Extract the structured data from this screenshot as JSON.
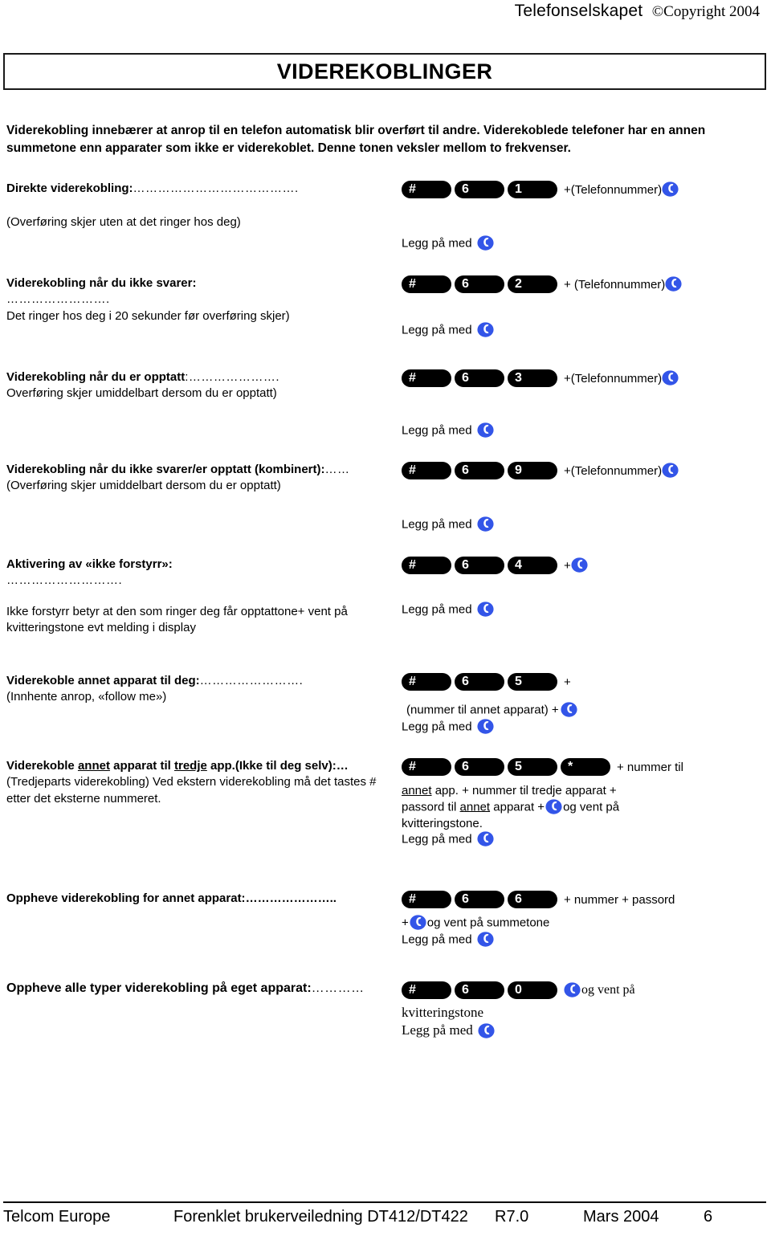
{
  "header": {
    "company": "Telefonselskapet",
    "copyright": "©Copyright 2004"
  },
  "title": "VIDEREKOBLINGER",
  "intro": "Viderekobling innebærer at anrop til en telefon automatisk blir overført til andre.  Viderekoblede telefoner har en annen summetone enn apparater som ikke er viderekoblet.  Denne tonen veksler mellom to frekvenser.",
  "hangup_label": "Legg på med",
  "icons": {
    "phone": "phone-handset-icon",
    "phone_color": "#3355E8"
  },
  "key_colors": {
    "key_bg": "#000000",
    "key_fg": "#ffffff"
  },
  "sections": [
    {
      "label": "Direkte viderekobling:",
      "leader": "………………………………….",
      "note": "(Overføring skjer uten at det ringer hos deg)",
      "keys": [
        "#",
        "6",
        "1"
      ],
      "after_keys": "+(Telefonnummer)",
      "after_keys_phone": true,
      "hangup": true
    },
    {
      "label": "Viderekobling når du ikke svarer:",
      "leader": "…………………….",
      "note": "Det ringer hos deg i 20 sekunder før overføring skjer)",
      "keys": [
        "#",
        "6",
        "2"
      ],
      "after_keys": "+  (Telefonnummer)",
      "after_keys_phone": true,
      "hangup": true
    },
    {
      "label": "Viderekobling når du er opptatt",
      "leader": ":………………….",
      "note": "Overføring skjer umiddelbart dersom du er opptatt)",
      "keys": [
        "#",
        "6",
        "3"
      ],
      "after_keys": "+(Telefonnummer)",
      "after_keys_phone": true,
      "hangup": true
    },
    {
      "label": "Viderekobling når du ikke svarer/er opptatt (kombinert):",
      "leader": "……",
      "note": " (Overføring skjer umiddelbart dersom du er opptatt)",
      "keys": [
        "#",
        "6",
        "9"
      ],
      "after_keys": "+(Telefonnummer)",
      "after_keys_phone": true,
      "hangup": true
    },
    {
      "label": "Aktivering av «ikke forstyrr»:",
      "leader": "……………………….",
      "note": "Ikke forstyrr betyr at den som ringer deg får opptattone+ vent på kvitteringstone evt melding i display",
      "keys": [
        "#",
        "6",
        "4"
      ],
      "after_keys": "+",
      "after_keys_phone": true,
      "hangup": true
    },
    {
      "label": "Viderekoble annet apparat til deg:",
      "leader": "…………………….",
      "note": "(Innhente anrop, «follow me»)",
      "keys": [
        "#",
        "6",
        "5"
      ],
      "after_keys": "+",
      "after_keys_phone": false,
      "extra_line": "(nummer til annet apparat) +",
      "extra_line_phone": true,
      "hangup": true
    }
  ],
  "third_party": {
    "label_bold_1": "Viderekoble ",
    "label_ul_1": "annet",
    "label_bold_2": " apparat til ",
    "label_ul_2": "tredje",
    "label_bold_3": " app.(Ikke til deg selv):",
    "leader": "…",
    "note": " (Tredjeparts viderekobling) Ved ekstern viderekobling må det tastes # etter det eksterne nummeret.",
    "keys": [
      "#",
      "6",
      "5",
      "*"
    ],
    "after_keys": "+ nummer til",
    "line2_a": "annet",
    "line2_b": " app. + nummer til tredje apparat  +",
    "line3_a": "passord til ",
    "line3_ul": "annet",
    "line3_b": " apparat +",
    "line3_c": "og vent på",
    "line4": "kvitteringstone.",
    "hangup": true
  },
  "cancel_other": {
    "label": "Oppheve viderekobling for annet apparat:",
    "leader": "…………………..",
    "keys": [
      "#",
      "6",
      "6"
    ],
    "after_keys": "+ nummer + passord",
    "line2_pre": "+",
    "line2_post": "og vent på summetone",
    "hangup": true
  },
  "cancel_all": {
    "label": "Oppheve alle typer viderekobling på eget apparat:",
    "leader": "…………",
    "keys": [
      "#",
      "6",
      "0"
    ],
    "after_keys": "og vent på",
    "line2": "kvitteringstone",
    "hangup": true
  },
  "footer": {
    "company": "Telcom Europe",
    "doc": "Forenklet brukerveiledning DT412/DT422",
    "revision": "R7.0",
    "date": "Mars 2004",
    "page": "6"
  }
}
